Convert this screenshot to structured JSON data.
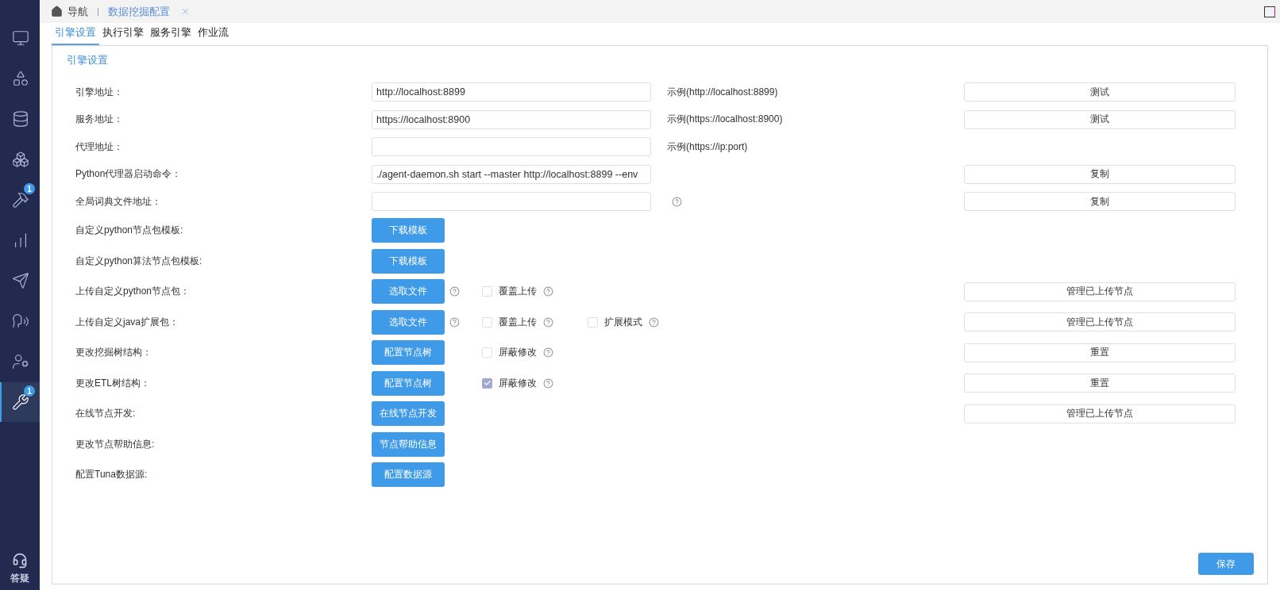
{
  "sidebar": {
    "items": [
      {
        "kind": "monitor",
        "selected": false
      },
      {
        "kind": "apps",
        "selected": false
      },
      {
        "kind": "database",
        "selected": false
      },
      {
        "kind": "boxes",
        "selected": false
      },
      {
        "kind": "hammer",
        "selected": false,
        "badge": "1"
      },
      {
        "kind": "chart",
        "selected": false
      },
      {
        "kind": "send",
        "selected": false
      },
      {
        "kind": "head",
        "selected": false
      },
      {
        "kind": "usergear",
        "selected": false
      },
      {
        "kind": "tools",
        "selected": true,
        "badge": "1"
      }
    ],
    "help": {
      "label": "答疑"
    }
  },
  "topbar": {
    "home": "导航",
    "tabs": [
      {
        "label": "数据挖掘配置",
        "selected": true
      }
    ]
  },
  "tabs": [
    {
      "label": "引擎设置",
      "selected": true
    },
    {
      "label": "执行引擎",
      "selected": false
    },
    {
      "label": "服务引擎",
      "selected": false
    },
    {
      "label": "作业流",
      "selected": false
    }
  ],
  "section": {
    "title": "引擎设置"
  },
  "rows": [
    {
      "label": "引擎地址：",
      "control": {
        "kind": "input",
        "value": "http://localhost:8899"
      },
      "hint": "示例(http://localhost:8899)",
      "action": "测试"
    },
    {
      "label": "服务地址：",
      "control": {
        "kind": "input",
        "value": "https://localhost:8900"
      },
      "hint": "示例(https://localhost:8900)",
      "action": "测试"
    },
    {
      "label": "代理地址：",
      "control": {
        "kind": "input"
      },
      "hint": "示例(https://ip:port)"
    },
    {
      "label": "Python代理器启动命令：",
      "control": {
        "kind": "input",
        "value": "./agent-daemon.sh start --master http://localhost:8899 --env"
      },
      "action": "复制"
    },
    {
      "label": "全局词典文件地址：",
      "control": {
        "kind": "input",
        "help": true
      },
      "action": "复制"
    },
    {
      "label": "自定义python节点包模板:",
      "control": {
        "kind": "button",
        "label": "下载模板"
      }
    },
    {
      "label": "自定义python算法节点包模板:",
      "control": {
        "kind": "button",
        "label": "下载模板"
      }
    },
    {
      "label": "上传自定义python节点包：",
      "control": {
        "kind": "button",
        "label": "选取文件",
        "help": true
      },
      "checks": [
        {
          "label": "覆盖上传",
          "checked": false
        }
      ],
      "action": "管理已上传节点"
    },
    {
      "label": "上传自定义java扩展包：",
      "control": {
        "kind": "button",
        "label": "选取文件",
        "help": true
      },
      "checks": [
        {
          "label": "覆盖上传",
          "checked": false
        },
        {
          "label": "扩展模式",
          "checked": false
        }
      ],
      "action": "管理已上传节点"
    },
    {
      "label": "更改挖掘树结构：",
      "control": {
        "kind": "button",
        "label": "配置节点树"
      },
      "checks": [
        {
          "label": "屏蔽修改",
          "checked": false
        }
      ],
      "action": "重置"
    },
    {
      "label": "更改ETL树结构：",
      "control": {
        "kind": "button",
        "label": "配置节点树"
      },
      "checks": [
        {
          "label": "屏蔽修改",
          "checked": true
        }
      ],
      "action": "重置"
    },
    {
      "label": "在线节点开发:",
      "control": {
        "kind": "button",
        "label": "在线节点开发"
      },
      "action": "管理已上传节点"
    },
    {
      "label": "更改节点帮助信息:",
      "control": {
        "kind": "button",
        "label": "节点帮助信息"
      }
    },
    {
      "label": "配置Tuna数据源:",
      "control": {
        "kind": "button",
        "label": "配置数据源"
      }
    }
  ],
  "save": "保存"
}
